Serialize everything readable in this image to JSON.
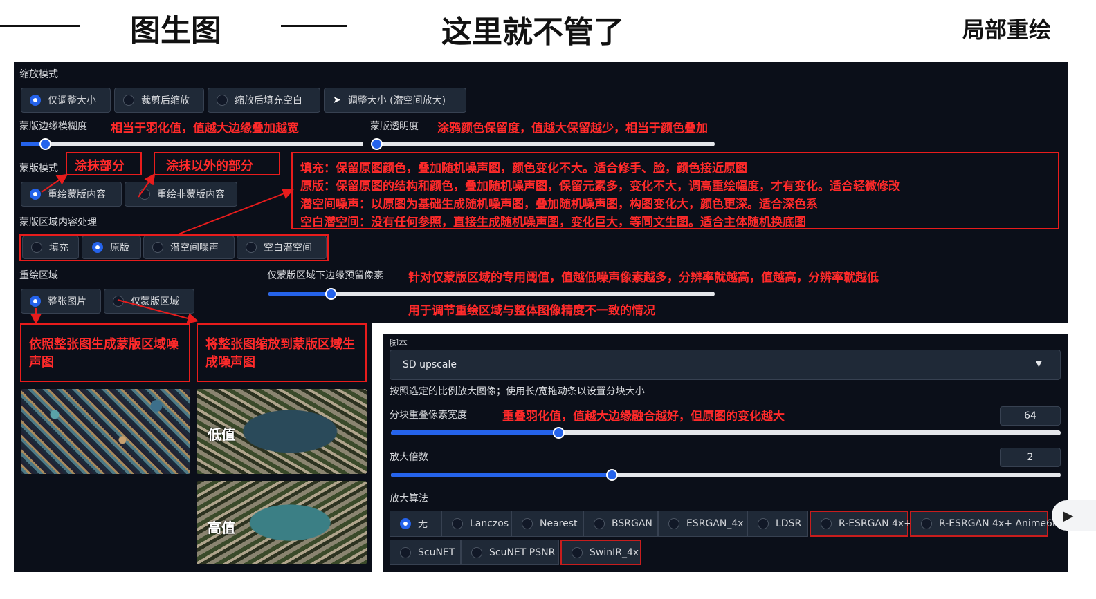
{
  "header": {
    "left_title": "图生图",
    "center_title": "这里就不管了",
    "right_title": "局部重绘"
  },
  "resize_mode": {
    "label": "缩放模式",
    "options": [
      "仅调整大小",
      "裁剪后缩放",
      "缩放后填充空白",
      "调整大小 (潜空间放大)"
    ],
    "selected": "仅调整大小"
  },
  "mask_blur": {
    "label": "蒙版边缘模糊度",
    "annotation": "相当于羽化值，值越大边缘叠加越宽",
    "level": 0.07
  },
  "mask_transparency": {
    "label": "蒙版透明度",
    "annotation": "涂鸦颜色保留度，值越大保留越少，相当于颜色叠加",
    "level": 0.0
  },
  "mask_mode": {
    "label": "蒙版模式",
    "annotation_a": "涂抹部分",
    "annotation_b": "涂抹以外的部分",
    "options": [
      "重绘蒙版内容",
      "重绘非蒙版内容"
    ],
    "selected": "重绘蒙版内容"
  },
  "fill_notes": [
    "填充：保留原图颜色，叠加随机噪声图，颜色变化不大。适合修手、脸，颜色接近原图",
    "原版：保留原图的结构和颜色，叠加随机噪声图，保留元素多，变化不大，调高重绘幅度，才有变化。适合轻微修改",
    "潜空间噪声：以原图为基础生成随机噪声图，叠加随机噪声图，构图变化大，颜色更深。适合深色系",
    "空白潜空间：没有任何参照，直接生成随机噪声图，变化巨大，等同文生图。适合主体随机换底图"
  ],
  "masked_content": {
    "label": "蒙版区域内容处理",
    "options": [
      "填充",
      "原版",
      "潜空间噪声",
      "空白潜空间"
    ],
    "selected": "原版"
  },
  "inpaint_area": {
    "label": "重绘区域",
    "options": [
      "整张图片",
      "仅蒙版区域"
    ],
    "selected": "整张图片",
    "note_whole": "依照整张图生成蒙版区域噪声图",
    "note_mask": "将整张图缩放到蒙版区域生成噪声图"
  },
  "padding": {
    "label": "仅蒙版区域下边缘预留像素",
    "annotation": "针对仅蒙版区域的专用阈值，值越低噪声像素越多，分辨率就越高，值越高，分辨率就越低",
    "annotation2": "用于调节重绘区域与整体图像精度不一致的情况",
    "level": 0.14
  },
  "image_labels": {
    "low": "低值",
    "high": "高值"
  },
  "script": {
    "label": "脚本",
    "value": "SD upscale",
    "description": "按照选定的比例放大图像；使用长/宽拖动条以设置分块大小",
    "overlap_label": "分块重叠像素宽度",
    "overlap_annotation": "重叠羽化值，值越大边缘融合越好，但原图的变化越大",
    "overlap_value": "64",
    "overlap_level": 0.25,
    "scale_label": "放大倍数",
    "scale_value": "2",
    "scale_level": 0.33,
    "upscaler_label": "放大算法",
    "upscalers_row1": [
      "无",
      "Lanczos",
      "Nearest",
      "BSRGAN",
      "ESRGAN_4x",
      "LDSR",
      "R-ESRGAN 4x+",
      "R-ESRGAN 4x+ Anime6B"
    ],
    "upscalers_row2": [
      "ScuNET",
      "ScuNET PSNR",
      "SwinIR_4x"
    ],
    "selected": "无"
  },
  "colors": {
    "panel_bg": "#0b0f19",
    "accent": "#2563eb",
    "annotation_red": "#ff2a2a"
  }
}
